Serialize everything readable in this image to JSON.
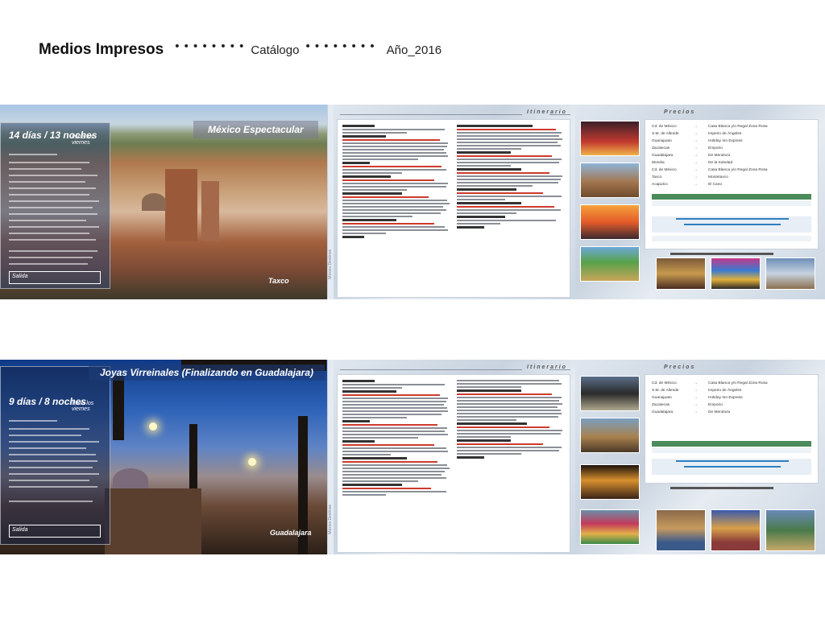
{
  "header": {
    "title": "Medios Impresos",
    "dots": "• • • • • • • •",
    "catalog": "Catálogo",
    "year": "Año_2016"
  },
  "spreads": [
    {
      "overlay_heading": "14 días / 13 noches",
      "overlay_sub": "Inicia los viernes",
      "overlay_field": "Salida",
      "title": "México Espectacular",
      "city": "Taxco",
      "spine": "México Destinos"
    },
    {
      "overlay_heading": "9 días / 8 noches",
      "overlay_sub": "Inicia los viernes",
      "overlay_field": "Salida",
      "title": "Joyas Virreinales (Finalizando en Guadalajara)",
      "city": "Guadalajara",
      "spine": "México Destinos"
    }
  ],
  "labels": {
    "itinerary": "Itinerario",
    "prices": "Precios"
  },
  "hotels_1": [
    {
      "city": "Cd. de México",
      "hotel": "Casa Blanca y/o Regal Zona Rosa"
    },
    {
      "city": "S.M. de Allende",
      "hotel": "Imperio de Ángeles"
    },
    {
      "city": "Guanajuato",
      "hotel": "Holiday Inn Express"
    },
    {
      "city": "Zacatecas",
      "hotel": "Emporio"
    },
    {
      "city": "Guadalajara",
      "hotel": "De Mendoza"
    },
    {
      "city": "Morelia",
      "hotel": "De la Soledad"
    },
    {
      "city": "Cd. de México",
      "hotel": "Casa Blanca y/o Regal Zona Rosa"
    },
    {
      "city": "Taxco",
      "hotel": "Montetaxco"
    },
    {
      "city": "Acapulco",
      "hotel": "El Cano"
    }
  ],
  "hotels_2": [
    {
      "city": "Cd. de México",
      "hotel": "Casa Blanca y/o Regal Zona Rosa"
    },
    {
      "city": "S.M. de Allende",
      "hotel": "Imperio de Ángeles"
    },
    {
      "city": "Guanajuato",
      "hotel": "Holiday Inn Express"
    },
    {
      "city": "Zacatecas",
      "hotel": "Emporio"
    },
    {
      "city": "Guadalajara",
      "hotel": "De Mendoza"
    }
  ]
}
